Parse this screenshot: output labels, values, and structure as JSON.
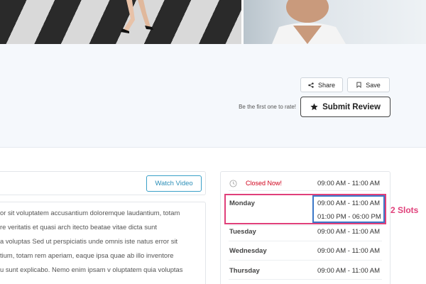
{
  "header": {
    "share_label": "Share",
    "save_label": "Save",
    "rate_prompt": "Be the first one to rate!",
    "submit_review_label": "Submit Review"
  },
  "description": {
    "watch_video_label": "Watch Video",
    "lines": [
      "or sit voluptatem accusantium doloremque laudantium, totam",
      "re veritatis et quasi arch itecto beatae vitae dicta sunt",
      "a voluptas Sed ut perspiciatis unde omnis iste natus error sit",
      "tium, totam rem aperiam, eaque ipsa quae ab illo inventore",
      "u sunt explicabo. Nemo enim ipsam v oluptatem quia voluptas"
    ]
  },
  "hours": {
    "status": "Closed Now!",
    "status_hours": "09:00 AM - 11:00 AM",
    "days": [
      {
        "day": "Monday",
        "slots": [
          "09:00 AM - 11:00 AM",
          "01:00 PM - 06:00 PM"
        ]
      },
      {
        "day": "Tuesday",
        "slots": [
          "09:00 AM - 11:00 AM"
        ]
      },
      {
        "day": "Wednesday",
        "slots": [
          "09:00 AM - 11:00 AM"
        ]
      },
      {
        "day": "Thursday",
        "slots": [
          "09:00 AM - 11:00 AM"
        ]
      }
    ]
  },
  "annotation": {
    "slots_label": "2 Slots",
    "highlight_color": "#e0407a",
    "slot_box_color": "#3b78c8"
  },
  "colors": {
    "accent": "#2c8fb8",
    "closed_status": "#d0021b"
  }
}
